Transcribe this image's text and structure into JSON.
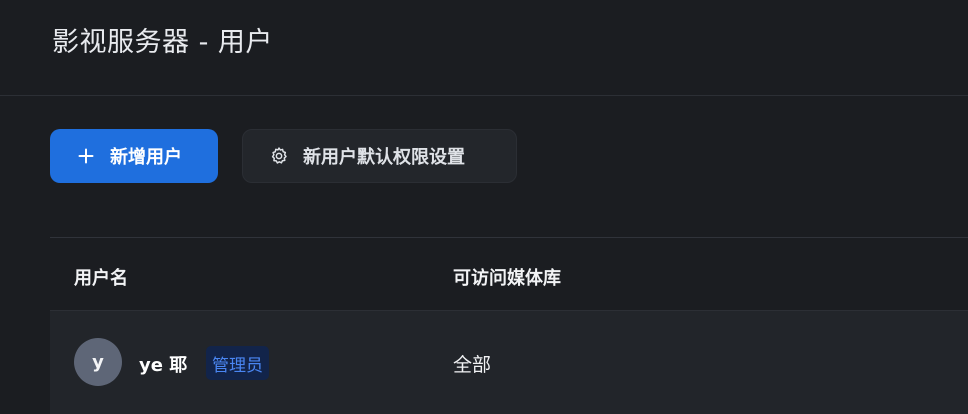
{
  "header": {
    "title": "影视服务器 - 用户"
  },
  "toolbar": {
    "add_user_label": "新增用户",
    "add_user_icon": "plus-icon",
    "default_permissions_label": "新用户默认权限设置",
    "default_permissions_icon": "gear-icon"
  },
  "table": {
    "columns": [
      "用户名",
      "可访问媒体库"
    ],
    "rows": [
      {
        "avatar_letter": "y",
        "username": "ye 耶",
        "role_badge": "管理员",
        "libraries": "全部"
      }
    ]
  },
  "colors": {
    "background": "#1b1d21",
    "primary": "#1f6fde",
    "badge_text": "#4a86f2",
    "badge_bg": "#12244a",
    "avatar": "#5e6677"
  }
}
